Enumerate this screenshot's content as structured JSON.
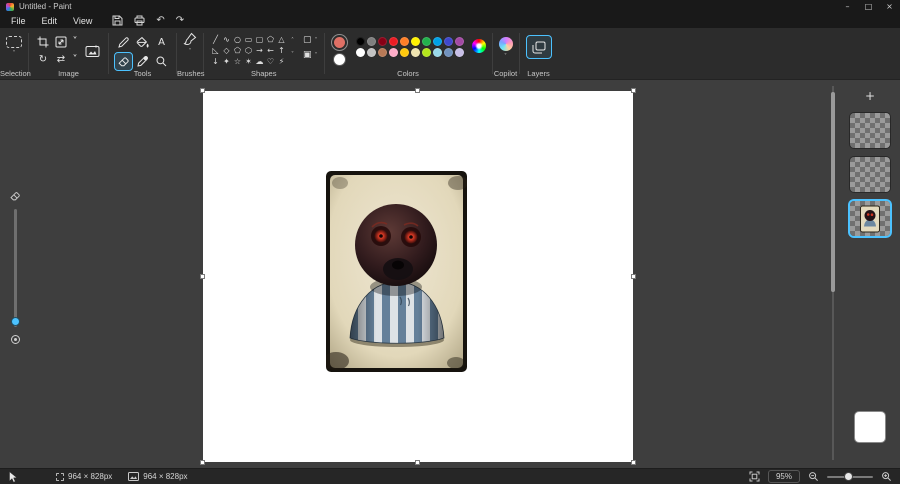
{
  "window": {
    "title": "Untitled - Paint"
  },
  "menubar": {
    "items": [
      "File",
      "Edit",
      "View"
    ]
  },
  "icons": {
    "minimize": "–",
    "maximize": "□",
    "close": "×",
    "undo": "↶",
    "redo": "↷",
    "chevron_down": "˅",
    "chevron_up": "˄",
    "rotate": "↻",
    "flip": "⇄",
    "text_tool": "A",
    "shape_outline": "▢",
    "shape_fill": "▣",
    "add_layer": "+"
  },
  "ribbon": {
    "groups": {
      "selection": "Selection",
      "image": "Image",
      "tools": "Tools",
      "brushes": "Brushes",
      "shapes": "Shapes",
      "colors": "Colors",
      "copilot": "Copilot",
      "layers": "Layers"
    }
  },
  "shapes": {
    "items": [
      {
        "name": "line",
        "glyph": "╱"
      },
      {
        "name": "curve",
        "glyph": "∿"
      },
      {
        "name": "oval",
        "glyph": "○"
      },
      {
        "name": "rectangle",
        "glyph": "▭"
      },
      {
        "name": "rounded-rectangle",
        "glyph": "▢"
      },
      {
        "name": "polygon",
        "glyph": "⬠"
      },
      {
        "name": "triangle",
        "glyph": "△"
      },
      {
        "name": "right-triangle",
        "glyph": "◺"
      },
      {
        "name": "diamond",
        "glyph": "◇"
      },
      {
        "name": "pentagon",
        "glyph": "⬠"
      },
      {
        "name": "hexagon",
        "glyph": "⬡"
      },
      {
        "name": "right-arrow",
        "glyph": "→"
      },
      {
        "name": "left-arrow",
        "glyph": "←"
      },
      {
        "name": "up-arrow",
        "glyph": "↑"
      },
      {
        "name": "down-arrow",
        "glyph": "↓"
      },
      {
        "name": "four-point-star",
        "glyph": "✦"
      },
      {
        "name": "five-point-star",
        "glyph": "☆"
      },
      {
        "name": "six-point-star",
        "glyph": "✶"
      },
      {
        "name": "cloud-callout",
        "glyph": "☁"
      },
      {
        "name": "heart",
        "glyph": "♡"
      },
      {
        "name": "lightning",
        "glyph": "⚡"
      }
    ]
  },
  "colors": {
    "color1": {
      "hex": "#df7065"
    },
    "color2": {
      "hex": "#ffffff"
    },
    "palette": [
      {
        "name": "black",
        "hex": "#000000"
      },
      {
        "name": "gray-50",
        "hex": "#7f7f7f"
      },
      {
        "name": "dark-red",
        "hex": "#880015"
      },
      {
        "name": "red",
        "hex": "#ed1c24"
      },
      {
        "name": "orange",
        "hex": "#ff7f27"
      },
      {
        "name": "yellow",
        "hex": "#fff200"
      },
      {
        "name": "green",
        "hex": "#22b14c"
      },
      {
        "name": "turquoise",
        "hex": "#00a2e8"
      },
      {
        "name": "indigo",
        "hex": "#3f48cc"
      },
      {
        "name": "purple",
        "hex": "#a349a4"
      },
      {
        "name": "white",
        "hex": "#ffffff"
      },
      {
        "name": "gray-25",
        "hex": "#c3c3c3"
      },
      {
        "name": "brown",
        "hex": "#b97a57"
      },
      {
        "name": "rose",
        "hex": "#ffaec9"
      },
      {
        "name": "gold",
        "hex": "#ffc90e"
      },
      {
        "name": "light-yellow",
        "hex": "#efe4b0"
      },
      {
        "name": "lime",
        "hex": "#b5e61d"
      },
      {
        "name": "light-turquoise",
        "hex": "#99d9ea"
      },
      {
        "name": "blue-gray",
        "hex": "#7092be"
      },
      {
        "name": "lavender",
        "hex": "#c8bfe7"
      }
    ]
  },
  "layers_panel": {
    "layers": [
      {
        "name": "layer-3",
        "type": "transparent",
        "selected": false
      },
      {
        "name": "layer-2",
        "type": "transparent",
        "selected": false
      },
      {
        "name": "layer-1",
        "type": "image",
        "selected": true
      }
    ],
    "background": {
      "hex": "#ffffff"
    }
  },
  "statusbar": {
    "selection_size": "964 × 828px",
    "canvas_size": "964 × 828px",
    "zoom": "95%"
  }
}
